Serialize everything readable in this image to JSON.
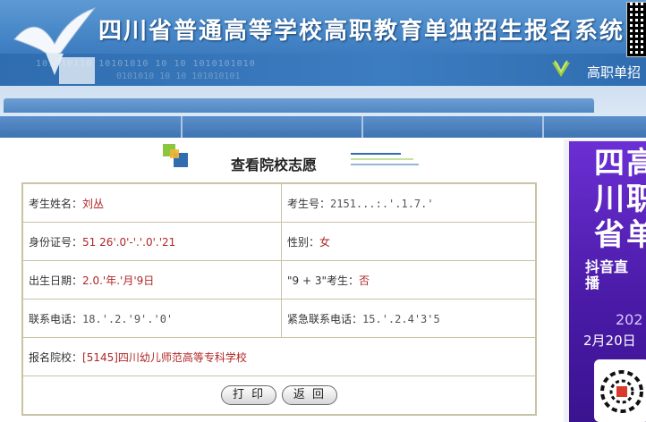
{
  "header": {
    "title": "四川省普通高等学校高职教育单独招生报名系统",
    "subtitle": "高职单招",
    "digits_row1": "101010110   10101010  10 10 1010101010",
    "digits_row2": "0101010   10 10 101010101"
  },
  "page": {
    "title": "查看院校志愿"
  },
  "info": {
    "name_label": "考生姓名：",
    "name_value": "刘丛",
    "exam_no_label": "考生号：",
    "exam_no_value": "2151...:.'.1.7.'",
    "id_label": "身份证号：",
    "id_value": "51 26'.0'-'.'.0'.'21",
    "gender_label": "性别：",
    "gender_value": "女",
    "dob_label": "出生日期：",
    "dob_value": "2.0.'年.'月'9日",
    "ninethree_label": "\"9 + 3\"考生：",
    "ninethree_value": "否",
    "phone_label": "联系电话：",
    "phone_value": "18.'.2.'9'.'0'",
    "emergency_label": "紧急联系电话：",
    "emergency_value": "15.'.2.4'3'5",
    "school_label": "报名院校：",
    "school_value": "[5145]四川幼儿师范高等专科学校"
  },
  "buttons": {
    "print": "打 印",
    "back": "返 回"
  },
  "poster": {
    "line1": "四",
    "line1b": "高",
    "line2": "川",
    "line2b": "职",
    "line3": "省",
    "line3b": "单",
    "douyin": "抖音直播",
    "year": "202",
    "date": "2月20日"
  },
  "colors": {
    "accent": "#b12525",
    "banner": "#3f7fc2",
    "table_border": "#c9c2a4",
    "poster": "#4b1ba8"
  }
}
